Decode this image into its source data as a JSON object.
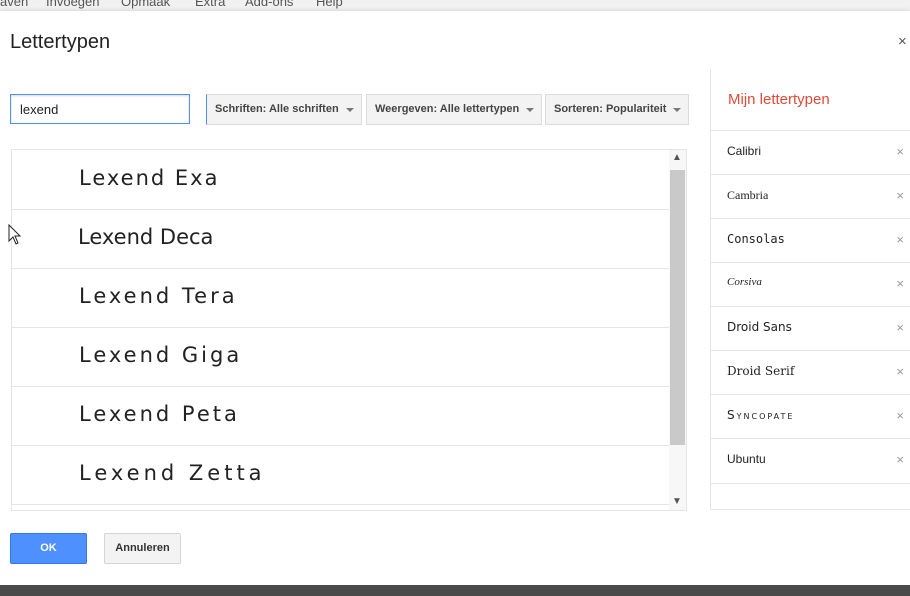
{
  "menubar": {
    "items": [
      "aven",
      "Invoegen",
      "Opmaak",
      "Extra",
      "Add-ons",
      "Help"
    ]
  },
  "dialog": {
    "title": "Lettertypen",
    "close_label": "×"
  },
  "search": {
    "value": "lexend"
  },
  "filters": {
    "scripts": "Schriften: Alle schriften",
    "show": "Weergeven: Alle lettertypen",
    "sort": "Sorteren: Populariteit"
  },
  "font_list": [
    {
      "name": "Lexend Exa"
    },
    {
      "name": "Lexend Deca"
    },
    {
      "name": "Lexend Tera"
    },
    {
      "name": "Lexend Giga"
    },
    {
      "name": "Lexend Peta"
    },
    {
      "name": "Lexend Zetta"
    }
  ],
  "my_fonts": {
    "title": "Mijn lettertypen",
    "items": [
      {
        "name": "Calibri"
      },
      {
        "name": "Cambria"
      },
      {
        "name": "Consolas"
      },
      {
        "name": "Corsiva"
      },
      {
        "name": "Droid Sans"
      },
      {
        "name": "Droid Serif"
      },
      {
        "name": "Syncopate"
      },
      {
        "name": "Ubuntu"
      }
    ],
    "remove_label": "×"
  },
  "buttons": {
    "ok": "OK",
    "cancel": "Annuleren"
  }
}
